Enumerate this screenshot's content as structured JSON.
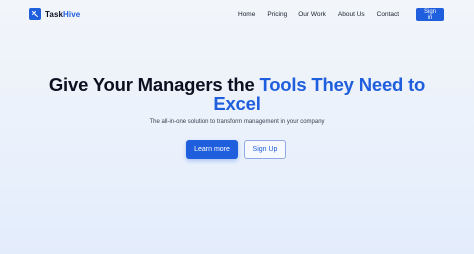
{
  "brand": {
    "name_prefix": "Task",
    "name_suffix": "Hive",
    "accent_color": "#1f5edc"
  },
  "nav": {
    "items": [
      {
        "label": "Home"
      },
      {
        "label": "Pricing"
      },
      {
        "label": "Our Work"
      },
      {
        "label": "About Us"
      },
      {
        "label": "Contact"
      }
    ],
    "signin_label": "Sign in"
  },
  "hero": {
    "title_part1": "Give Your Managers the ",
    "title_highlight_line1": "Tools They Need to",
    "title_highlight_line2": "Excel",
    "subtitle": "The all-in-one solution to transform management in your company",
    "primary_button": "Learn more",
    "secondary_button": "Sign Up"
  }
}
